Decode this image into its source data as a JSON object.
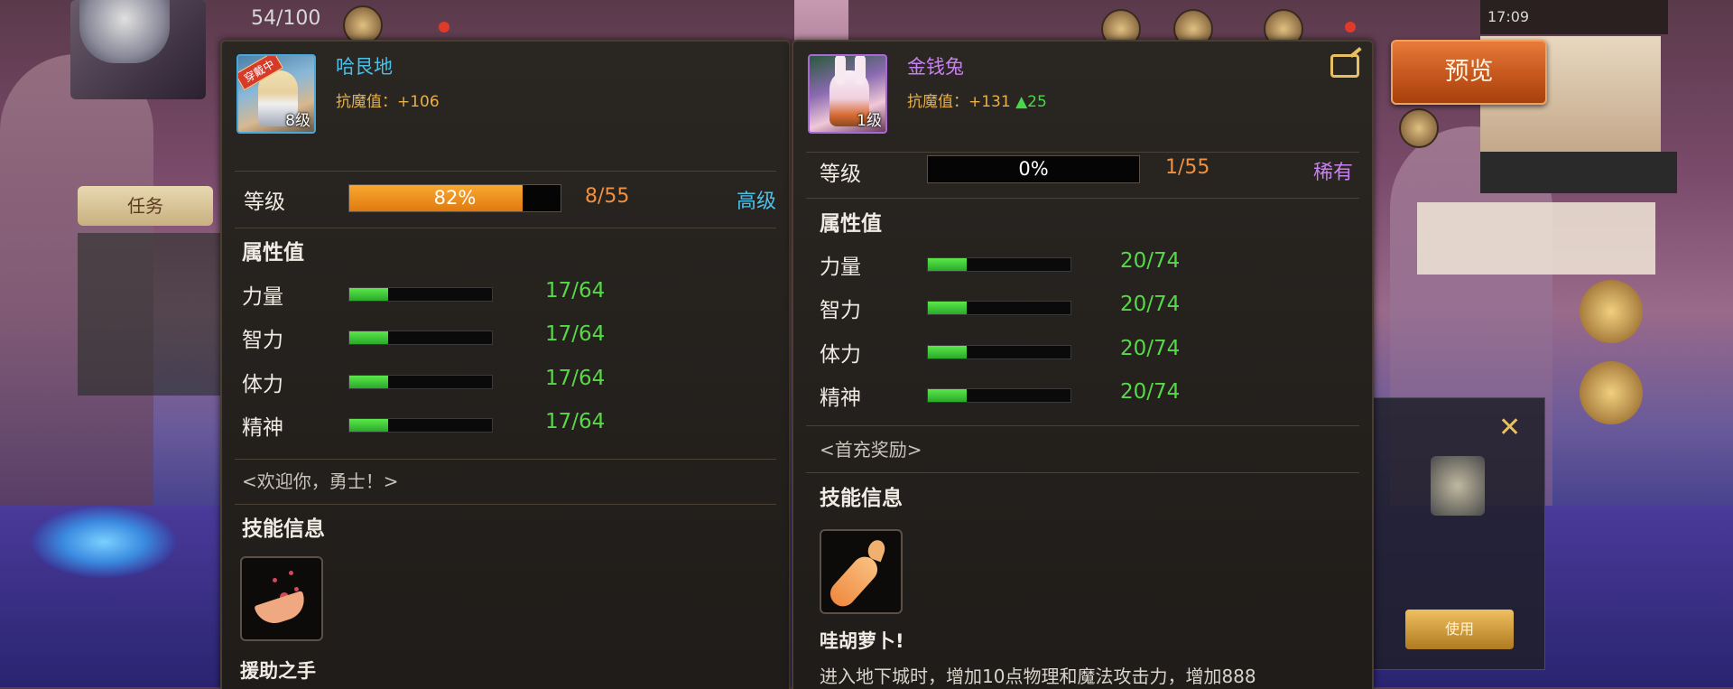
{
  "background": {
    "energy": "54/100",
    "status_time": "17:09",
    "quest_tab": "任务",
    "item_use_button": "使用"
  },
  "left_pet": {
    "name": "哈艮地",
    "badge": "穿戴中",
    "level_badge": "8级",
    "resist_label": "抗魔值：",
    "resist_value": "+106",
    "level_label": "等级",
    "level_pct": "82%",
    "level_fill": 0.82,
    "level_count": "8/55",
    "rarity": "高级",
    "attributes_title": "属性值",
    "stats": [
      {
        "label": "力量",
        "value": "17/64",
        "fill": 0.27
      },
      {
        "label": "智力",
        "value": "17/64",
        "fill": 0.27
      },
      {
        "label": "体力",
        "value": "17/64",
        "fill": 0.27
      },
      {
        "label": "精神",
        "value": "17/64",
        "fill": 0.27
      }
    ],
    "note": "<欢迎你，勇士！>",
    "skill_title": "技能信息",
    "skill_name": "援助之手"
  },
  "right_pet": {
    "name": "金钱兔",
    "level_badge": "1级",
    "resist_label": "抗魔值：",
    "resist_value": "+131",
    "resist_up": "▲25",
    "level_label": "等级",
    "level_pct": "0%",
    "level_fill": 0,
    "level_count": "1/55",
    "rarity": "稀有",
    "attributes_title": "属性值",
    "stats": [
      {
        "label": "力量",
        "value": "20/74",
        "fill": 0.27
      },
      {
        "label": "智力",
        "value": "20/74",
        "fill": 0.27
      },
      {
        "label": "体力",
        "value": "20/74",
        "fill": 0.27
      },
      {
        "label": "精神",
        "value": "20/74",
        "fill": 0.27
      }
    ],
    "note": "<首充奖励>",
    "skill_title": "技能信息",
    "skill_name": "哇胡萝卜!",
    "skill_desc": "进入地下城时，增加10点物理和魔法攻击力，增加888"
  },
  "preview_button": "预览",
  "colors": {
    "level_fill": "#f09020",
    "stat_fill": "#3ac83a",
    "rarity_high": "#4ac0e8",
    "rarity_rare": "#c880f0",
    "resist": "#e8b048",
    "preview_bg": "#c85a20"
  },
  "icons": [
    "share-icon",
    "helping-hand-skill-icon",
    "carrot-skill-icon"
  ]
}
